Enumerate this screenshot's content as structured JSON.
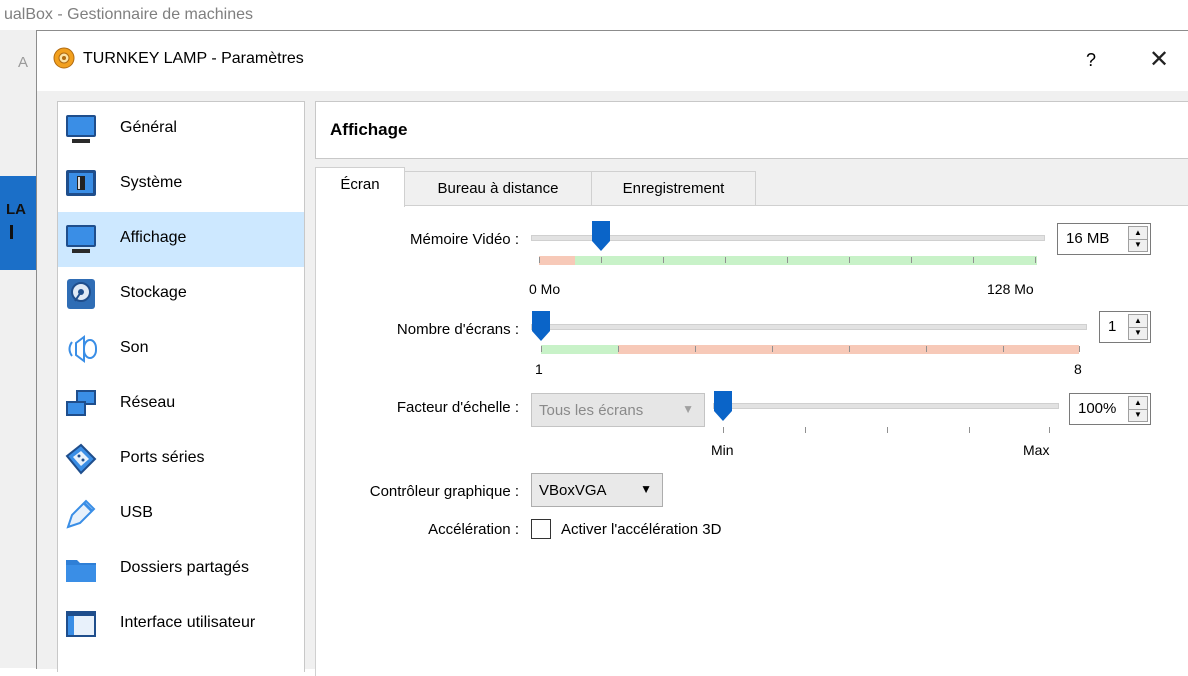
{
  "background": {
    "window_title": "ualBox - Gestionnaire de machines",
    "partial_label": "LA",
    "partial_letter": "A"
  },
  "dialog": {
    "title": "TURNKEY LAMP - Paramètres",
    "help_label": "?",
    "close_label": "✕"
  },
  "sidebar": {
    "items": [
      {
        "label": "Général",
        "icon": "monitor-icon",
        "active": false
      },
      {
        "label": "Système",
        "icon": "motherboard-icon",
        "active": false
      },
      {
        "label": "Affichage",
        "icon": "display-icon",
        "active": true
      },
      {
        "label": "Stockage",
        "icon": "storage-icon",
        "active": false
      },
      {
        "label": "Son",
        "icon": "speaker-icon",
        "active": false
      },
      {
        "label": "Réseau",
        "icon": "network-icon",
        "active": false
      },
      {
        "label": "Ports séries",
        "icon": "serial-port-icon",
        "active": false
      },
      {
        "label": "USB",
        "icon": "usb-icon",
        "active": false
      },
      {
        "label": "Dossiers partagés",
        "icon": "folder-icon",
        "active": false
      },
      {
        "label": "Interface utilisateur",
        "icon": "window-icon",
        "active": false
      }
    ]
  },
  "section": {
    "title": "Affichage"
  },
  "tabs": [
    {
      "label": "Écran",
      "active": true
    },
    {
      "label": "Bureau à distance",
      "active": false
    },
    {
      "label": "Enregistrement",
      "active": false
    }
  ],
  "video_memory": {
    "label": "Mémoire Vidéo :",
    "value": "16 MB",
    "min_label": "0 Mo",
    "max_label": "128 Mo",
    "min": 0,
    "max": 128,
    "current": 16
  },
  "screens": {
    "label": "Nombre d'écrans :",
    "value": "1",
    "min_label": "1",
    "max_label": "8",
    "min": 1,
    "max": 8,
    "current": 1
  },
  "scale": {
    "label": "Facteur d'échelle :",
    "dropdown_value": "Tous les écrans",
    "value": "100%",
    "min_label": "Min",
    "max_label": "Max",
    "level": 0
  },
  "graphics_controller": {
    "label": "Contrôleur graphique :",
    "value": "VBoxVGA"
  },
  "acceleration": {
    "label": "Accélération :",
    "checkbox_label": "Activer l'accélération 3D",
    "checked": false
  },
  "colors": {
    "accent": "#0a64c8",
    "selection": "#cde8ff",
    "good_zone": "#c8f2c8",
    "bad_zone": "#f7c9b8"
  }
}
